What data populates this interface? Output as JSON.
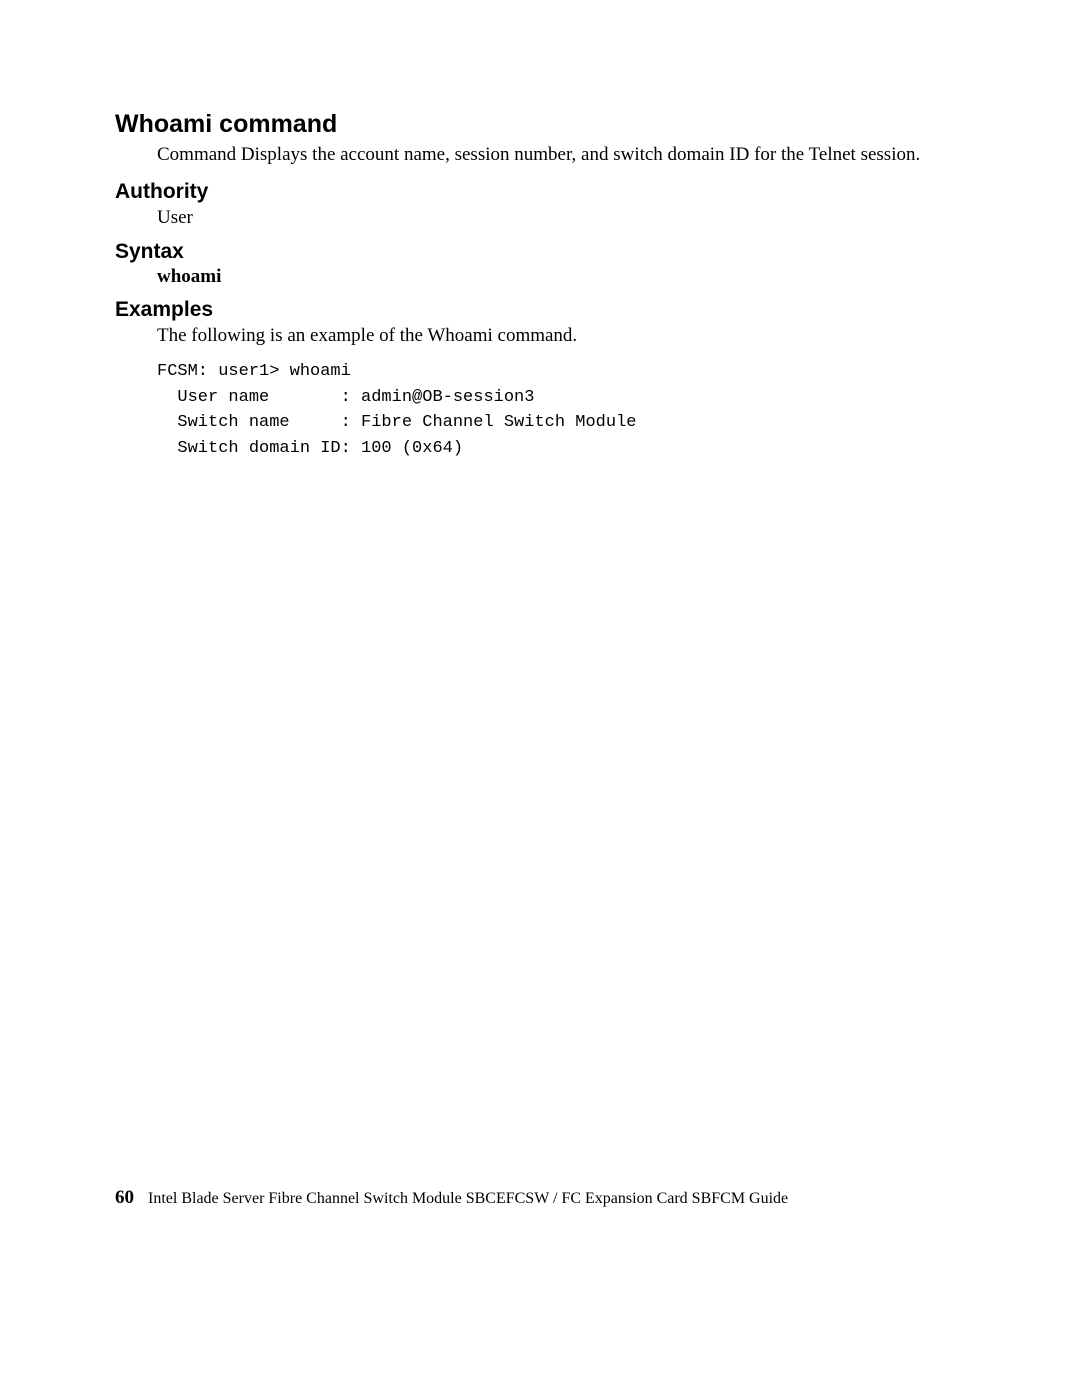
{
  "title": "Whoami command",
  "description": "Command Displays the account name, session number, and switch domain ID for the Telnet session.",
  "sections": {
    "authority": {
      "heading": "Authority",
      "text": "User"
    },
    "syntax": {
      "heading": "Syntax",
      "text": "whoami"
    },
    "examples": {
      "heading": "Examples",
      "intro": "The following is an example of the Whoami command.",
      "code": "FCSM: user1> whoami\n  User name       : admin@OB-session3\n  Switch name     : Fibre Channel Switch Module\n  Switch domain ID: 100 (0x64)"
    }
  },
  "footer": {
    "page": "60",
    "text": "Intel Blade Server Fibre Channel Switch Module SBCEFCSW / FC Expansion Card SBFCM Guide"
  }
}
